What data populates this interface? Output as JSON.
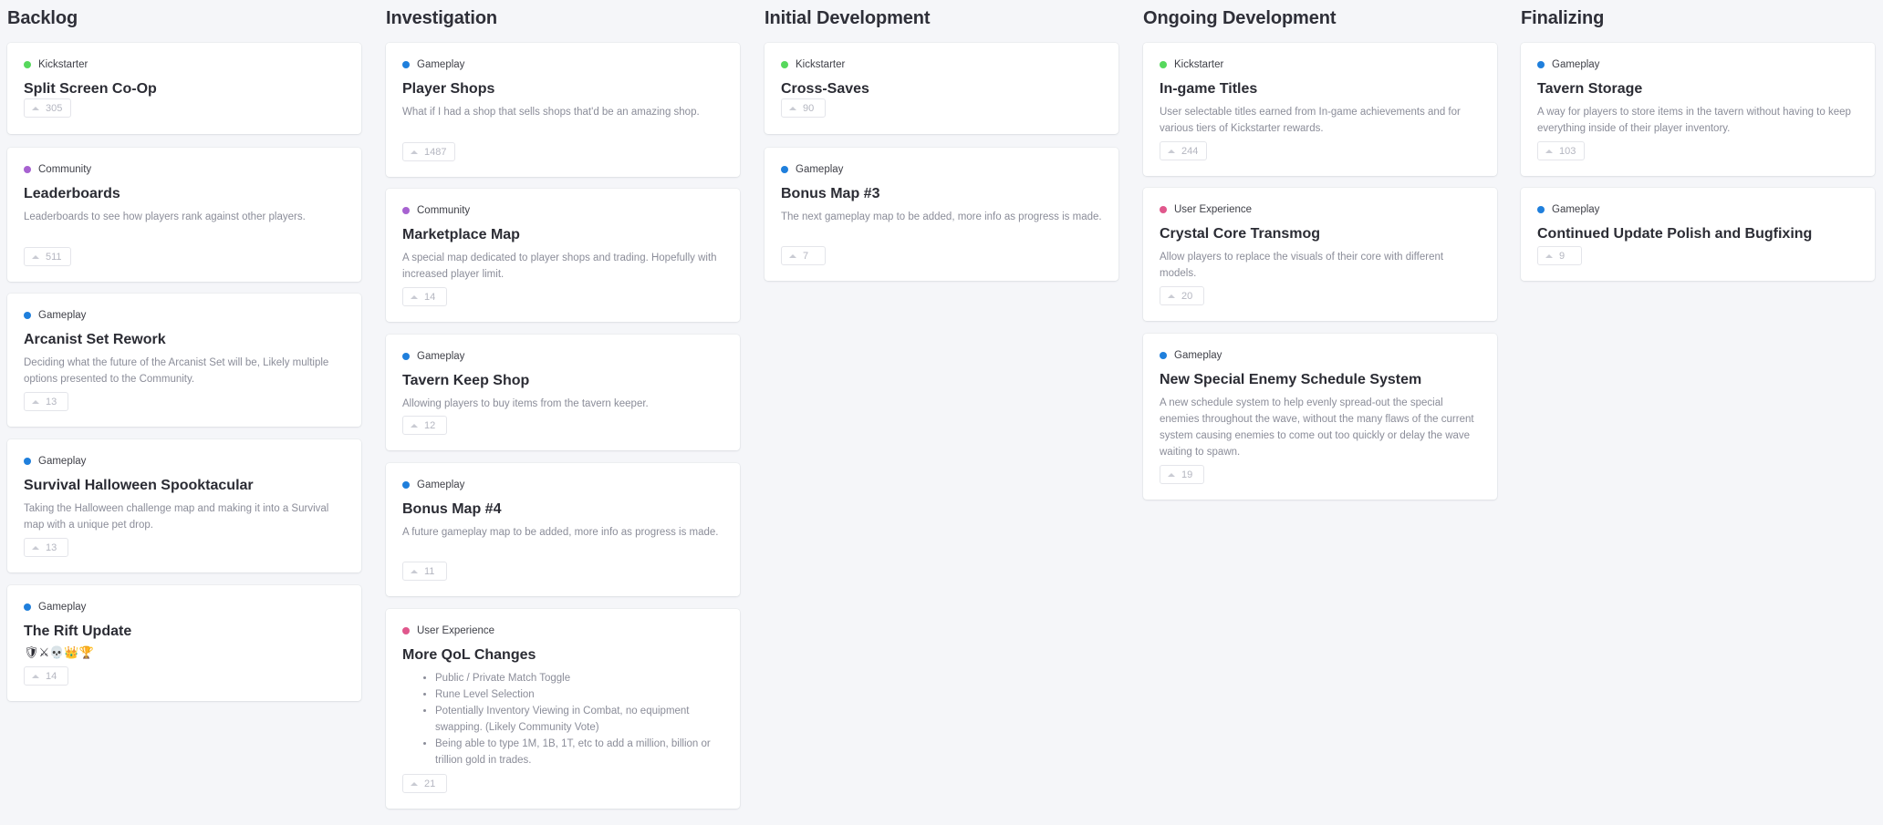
{
  "colors": {
    "Kickstarter": "#56d85c",
    "Community": "#a762d1",
    "Gameplay": "#1f7fdc",
    "User Experience": "#e0578c"
  },
  "columns": [
    {
      "title": "Backlog",
      "cards": [
        {
          "tag": "Kickstarter",
          "title": "Split Screen Co-Op",
          "votes": "305"
        },
        {
          "tag": "Community",
          "title": "Leaderboards",
          "desc": "Leaderboards to see how players rank against other players.",
          "votes": "511"
        },
        {
          "tag": "Gameplay",
          "title": "Arcanist Set Rework",
          "desc": "Deciding what the future of the Arcanist Set will be, Likely multiple options presented to the Community.",
          "votes": "13"
        },
        {
          "tag": "Gameplay",
          "title": "Survival Halloween Spooktacular",
          "desc": "Taking the Halloween challenge map and making it into a Survival map with a unique pet drop.",
          "votes": "13"
        },
        {
          "tag": "Gameplay",
          "title": "The Rift Update",
          "emoji": "🛡⚔💀👑🏆",
          "votes": "14"
        }
      ]
    },
    {
      "title": "Investigation",
      "cards": [
        {
          "tag": "Gameplay",
          "title": "Player Shops",
          "desc": "What if I had a shop that sells shops that'd be an amazing shop.",
          "votes": "1487"
        },
        {
          "tag": "Community",
          "title": "Marketplace Map",
          "desc": "A special map dedicated to player shops and trading. Hopefully with increased player limit.",
          "votes": "14"
        },
        {
          "tag": "Gameplay",
          "title": "Tavern Keep Shop",
          "desc": "Allowing players to buy items from the tavern keeper.",
          "votes": "12"
        },
        {
          "tag": "Gameplay",
          "title": "Bonus Map #4",
          "desc": "A future gameplay map to be added, more info as progress is made.",
          "votes": "11"
        },
        {
          "tag": "User Experience",
          "title": "More QoL Changes",
          "list": [
            "Public / Private Match Toggle",
            "Rune Level Selection",
            "Potentially Inventory Viewing in Combat, no equipment swapping. (Likely Community Vote)",
            "Being able to type 1M, 1B, 1T, etc to add a million, billion or trillion gold in trades."
          ],
          "votes": "21"
        }
      ]
    },
    {
      "title": "Initial Development",
      "cards": [
        {
          "tag": "Kickstarter",
          "title": "Cross-Saves",
          "votes": "90"
        },
        {
          "tag": "Gameplay",
          "title": "Bonus Map #3",
          "desc": "The next gameplay map to be added, more info as progress is made.",
          "votes": "7"
        }
      ]
    },
    {
      "title": "Ongoing Development",
      "cards": [
        {
          "tag": "Kickstarter",
          "title": "In-game Titles",
          "desc": "User selectable titles earned from In-game achievements and for various tiers of Kickstarter rewards.",
          "votes": "244"
        },
        {
          "tag": "User Experience",
          "title": "Crystal Core Transmog",
          "desc": "Allow players to replace the visuals of their core with different models.",
          "votes": "20"
        },
        {
          "tag": "Gameplay",
          "title": "New Special Enemy Schedule System",
          "desc": "A new schedule system to help evenly spread-out the special enemies throughout the wave, without the many flaws of the current system causing enemies to come out too quickly or delay the wave waiting to spawn.",
          "votes": "19"
        }
      ]
    },
    {
      "title": "Finalizing",
      "cards": [
        {
          "tag": "Gameplay",
          "title": "Tavern Storage",
          "desc": "A way for players to store items in the tavern without having to keep everything inside of their player inventory.",
          "votes": "103"
        },
        {
          "tag": "Gameplay",
          "title": "Continued Update Polish and Bugfixing",
          "votes": "9"
        }
      ]
    }
  ]
}
